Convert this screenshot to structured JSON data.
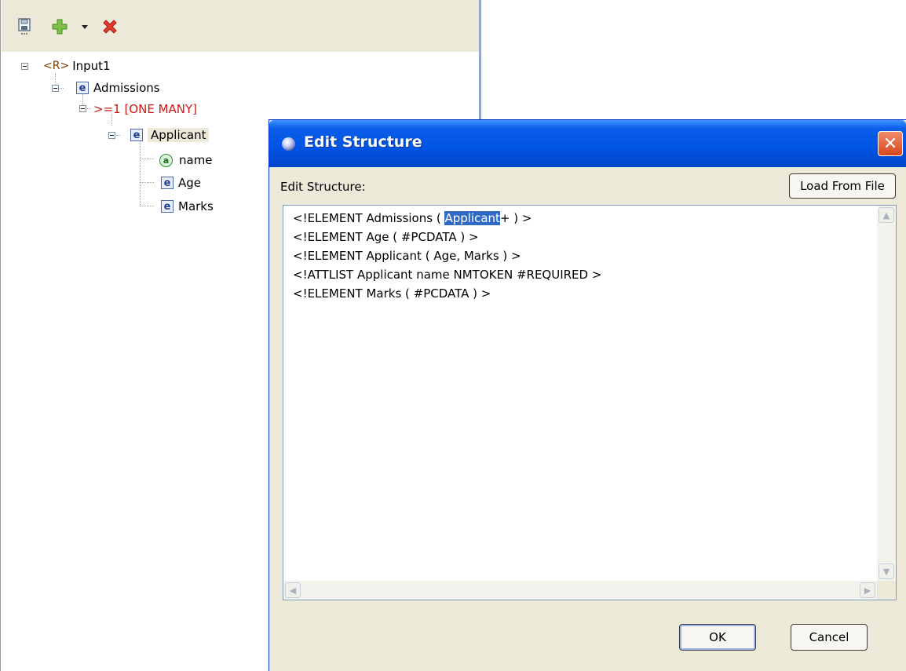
{
  "left_panel": {
    "toolbar": {
      "save_icon": "save-icon",
      "add_icon": "add-icon",
      "dropdown_icon": "chevron-down-icon",
      "delete_icon": "delete-icon"
    },
    "tree": {
      "root": {
        "badge": "<R>",
        "label": "Input1"
      },
      "admissions": {
        "label": "Admissions"
      },
      "cardinality": {
        "label": ">=1 [ONE MANY]",
        "color": "#d11818"
      },
      "applicant": {
        "label": "Applicant"
      },
      "name_attr": {
        "label": "name"
      },
      "age": {
        "label": "Age"
      },
      "marks": {
        "label": "Marks"
      }
    }
  },
  "dialog": {
    "title": "Edit Structure",
    "close_glyph": "✕",
    "field_label": "Edit Structure:",
    "load_button": "Load From File",
    "editor": {
      "line1_prefix": "<!ELEMENT Admissions ( ",
      "line1_selected": "Applicant",
      "line1_suffix": "+ ) >",
      "line2": "<!ELEMENT Age ( #PCDATA ) >",
      "line3": "<!ELEMENT Applicant ( Age, Marks ) >",
      "line4": "<!ATTLIST Applicant name NMTOKEN #REQUIRED >",
      "line5": "<!ELEMENT Marks ( #PCDATA ) >"
    },
    "ok_button": "OK",
    "cancel_button": "Cancel",
    "colors": {
      "title_bar": "#0054e3",
      "selection": "#316ac5"
    }
  }
}
